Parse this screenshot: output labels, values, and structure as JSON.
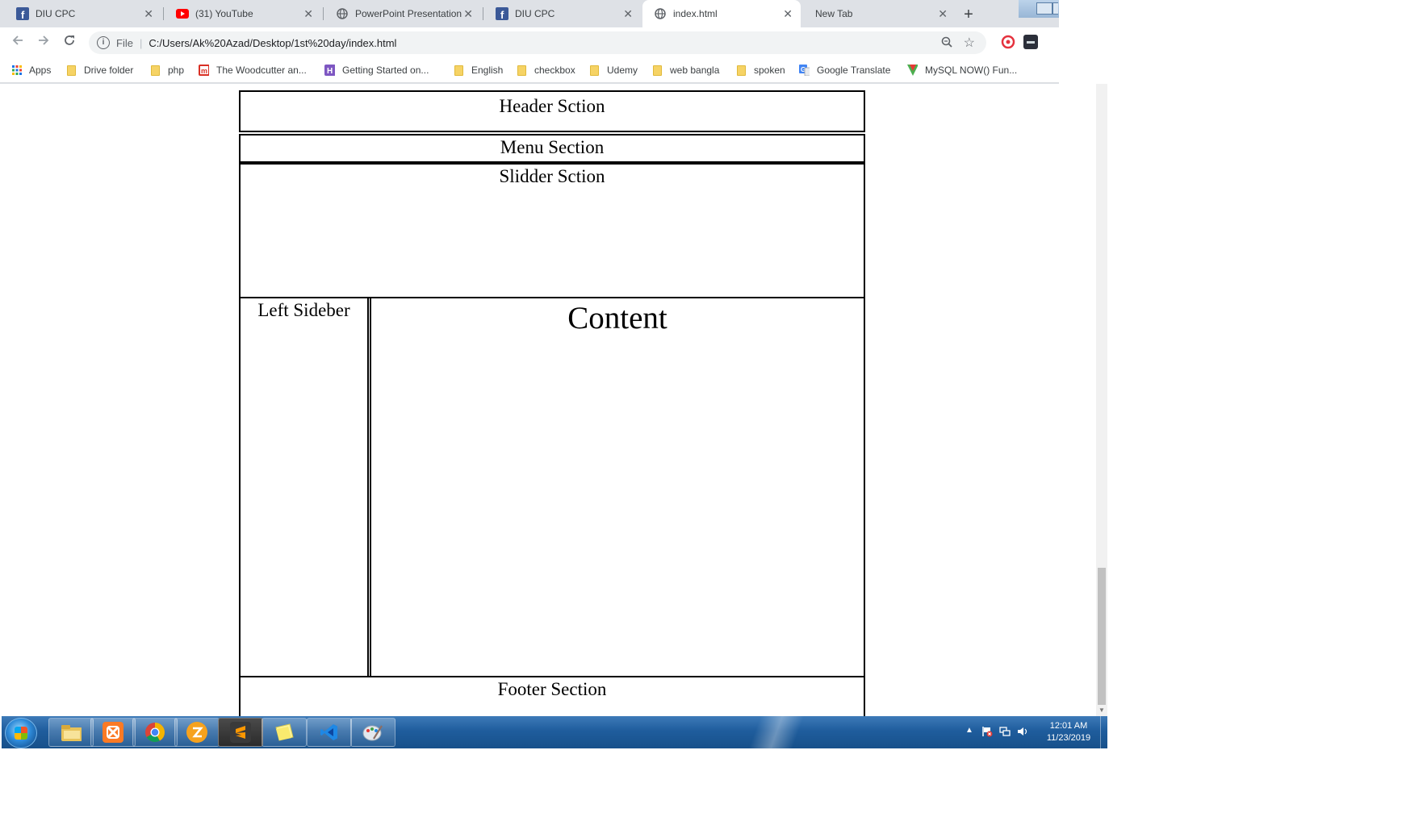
{
  "browser": {
    "tabs": [
      {
        "title": "DIU CPC",
        "icon": "facebook-icon",
        "active": false
      },
      {
        "title": "(31) YouTube",
        "icon": "youtube-icon",
        "active": false
      },
      {
        "title": "PowerPoint Presentation",
        "icon": "globe-icon",
        "active": false
      },
      {
        "title": "DIU CPC",
        "icon": "facebook-icon",
        "active": false
      },
      {
        "title": "index.html",
        "icon": "globe-icon",
        "active": true
      },
      {
        "title": "New Tab",
        "icon": "",
        "active": false
      }
    ],
    "close_glyph": "✕",
    "new_tab_glyph": "+",
    "address": {
      "scheme_label": "File",
      "url": "C:/Users/Ak%20Azad/Desktop/1st%20day/index.html"
    },
    "bookmarks": [
      {
        "label": "Apps",
        "icon": "apps-grid-icon"
      },
      {
        "label": "Drive folder",
        "icon": "folder-icon"
      },
      {
        "label": "php",
        "icon": "folder-icon"
      },
      {
        "label": "The Woodcutter an...",
        "icon": "m-logo-icon"
      },
      {
        "label": "Getting Started on...",
        "icon": "h-logo-icon"
      },
      {
        "label": "English",
        "icon": "folder-icon"
      },
      {
        "label": "checkbox",
        "icon": "folder-icon"
      },
      {
        "label": "Udemy",
        "icon": "folder-icon"
      },
      {
        "label": "web bangla",
        "icon": "folder-icon"
      },
      {
        "label": "spoken",
        "icon": "folder-icon"
      },
      {
        "label": "Google Translate",
        "icon": "google-translate-icon"
      },
      {
        "label": "MySQL NOW() Fun...",
        "icon": "w3schools-icon"
      }
    ]
  },
  "page": {
    "header": "Header Sction",
    "menu": "Menu Section",
    "slider": "Slidder Sction",
    "sidebar": "Left Sideber",
    "content": "Content",
    "footer": "Footer Section"
  },
  "taskbar": {
    "apps": [
      "file-explorer-icon",
      "xampp-icon",
      "chrome-icon",
      "filezilla-icon",
      "sublime-text-icon",
      "sticky-notes-icon",
      "vscode-icon",
      "paint-icon"
    ],
    "clock_time": "12:01 AM",
    "clock_date": "11/23/2019"
  },
  "colors": {
    "tab_strip": "#dee1e6",
    "taskbar": "#1f5d9d",
    "page_border": "#000000"
  }
}
